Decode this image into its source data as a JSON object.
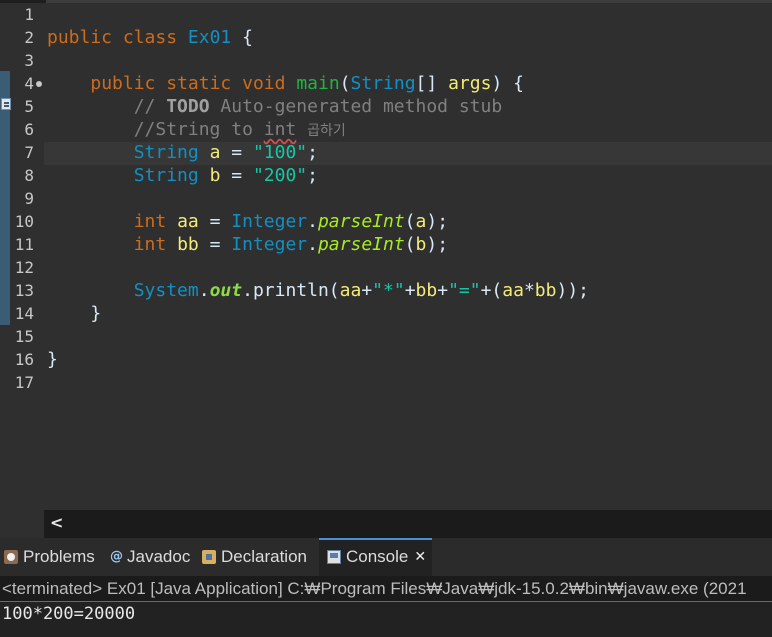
{
  "editor": {
    "line_numbers": [
      "1",
      "2",
      "3",
      "4",
      "5",
      "6",
      "7",
      "8",
      "9",
      "10",
      "11",
      "12",
      "13",
      "14",
      "15",
      "16",
      "17"
    ],
    "code": {
      "l2": {
        "kw1": "public",
        "kw2": "class",
        "cls": "Ex01",
        "brace": "{"
      },
      "l4": {
        "kw1": "public",
        "kw2": "static",
        "kw3": "void",
        "method": "main",
        "paren_open": "(",
        "type": "String",
        "brackets": "[]",
        "param": "args",
        "paren_close": ")",
        "brace": "{"
      },
      "l5": {
        "prefix": "// ",
        "todo": "TODO",
        "rest": " Auto-generated method stub"
      },
      "l6": {
        "prefix": "//String to ",
        "int_word": "int",
        "korean": "곱하기"
      },
      "l7": {
        "type": "String",
        "var": "a",
        "eq": " = ",
        "str": "\"100\"",
        "semi": ";"
      },
      "l8": {
        "type": "String",
        "var": "b",
        "eq": " = ",
        "str": "\"200\"",
        "semi": ";"
      },
      "l10": {
        "type": "int",
        "var": "aa",
        "eq": " = ",
        "cls": "Integer",
        "dot": ".",
        "method": "parseInt",
        "open": "(",
        "arg": "a",
        "close": ");"
      },
      "l11": {
        "type": "int",
        "var": "bb",
        "eq": " = ",
        "cls": "Integer",
        "dot": ".",
        "method": "parseInt",
        "open": "(",
        "arg": "b",
        "close": ");"
      },
      "l13": {
        "cls": "System",
        "dot1": ".",
        "field": "out",
        "dot2": ".",
        "method": "println",
        "open": "(",
        "v1": "aa",
        "plus1": "+",
        "s1": "\"*\"",
        "plus2": "+",
        "v2": "bb",
        "plus3": "+",
        "s2": "\"=\"",
        "plus4": "+(",
        "v3": "aa",
        "mul": "*",
        "v4": "bb",
        "close": "));"
      },
      "l14": {
        "brace": "}"
      },
      "l16": {
        "brace": "}"
      }
    }
  },
  "hscroll": {
    "left_arrow": "<"
  },
  "tabs": [
    {
      "label": "Problems",
      "icon": "problems-icon"
    },
    {
      "label": "Javadoc",
      "icon": "javadoc-icon",
      "glyph": "@"
    },
    {
      "label": "Declaration",
      "icon": "declaration-icon"
    },
    {
      "label": "Console",
      "icon": "console-icon",
      "close": "✕"
    }
  ],
  "console": {
    "status": "<terminated> Ex01 [Java Application] C:₩Program Files₩Java₩jdk-15.0.2₩bin₩javaw.exe  (2021",
    "output": "100*200=20000"
  },
  "colors": {
    "background": "#2f2f2f",
    "keyword": "#cc6c1d",
    "class": "#1290c3",
    "variable": "#f3ec79",
    "string": "#17c6a3",
    "comment": "#808080",
    "method": "#1eb540",
    "static_method": "#a7ec21",
    "field": "#8dda48"
  }
}
